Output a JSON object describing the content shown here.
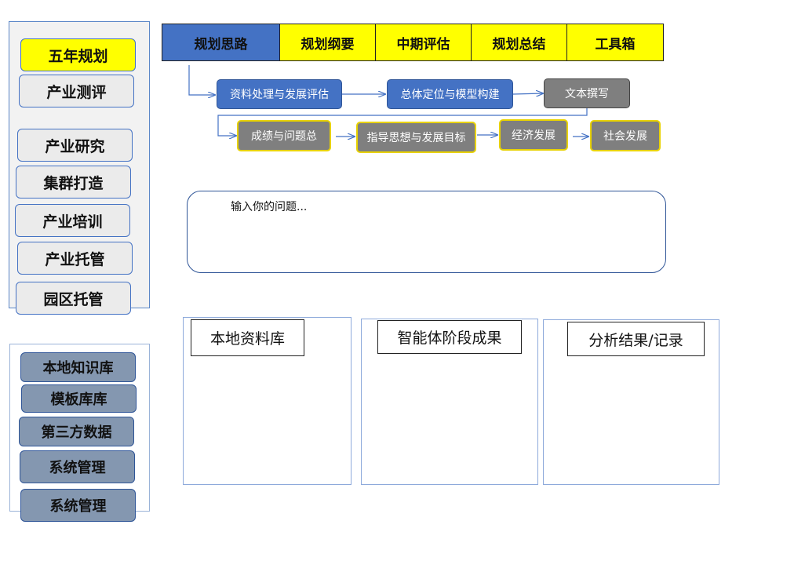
{
  "left_menu": {
    "items": [
      {
        "label": "五年规划",
        "active": true
      },
      {
        "label": "产业测评",
        "active": false
      },
      {
        "label": "产业研究",
        "active": false
      },
      {
        "label": "集群打造",
        "active": false
      },
      {
        "label": "产业培训",
        "active": false
      },
      {
        "label": "产业托管",
        "active": false
      },
      {
        "label": "园区托管",
        "active": false
      }
    ]
  },
  "knowledge_menu": {
    "items": [
      {
        "label": "本地知识库"
      },
      {
        "label": "模板库库"
      },
      {
        "label": "第三方数据"
      },
      {
        "label": "系统管理"
      },
      {
        "label": "系统管理"
      }
    ]
  },
  "tabs": [
    {
      "label": "规划思路",
      "active": true
    },
    {
      "label": "规划纲要",
      "active": false
    },
    {
      "label": "中期评估",
      "active": false
    },
    {
      "label": "规划总结",
      "active": false
    },
    {
      "label": "工具箱",
      "active": false
    }
  ],
  "flow": {
    "row1": [
      {
        "label": "资料处理与发展评估"
      },
      {
        "label": "总体定位与模型构建"
      },
      {
        "label": "文本撰写"
      }
    ],
    "row2": [
      {
        "label": "成绩与问题总"
      },
      {
        "label": "指导思想与发展目标"
      },
      {
        "label": "经济发展"
      },
      {
        "label": "社会发展"
      }
    ]
  },
  "question": {
    "placeholder": "输入你的问题..."
  },
  "panels": [
    {
      "label": "本地资料库"
    },
    {
      "label": "智能体阶段成果"
    },
    {
      "label": "分析结果/记录"
    }
  ],
  "colors": {
    "active_yellow": "#ffff00",
    "tab_blue": "#4472c4",
    "step_gray": "#7f7f7f",
    "kb_slate": "#8497b0"
  }
}
